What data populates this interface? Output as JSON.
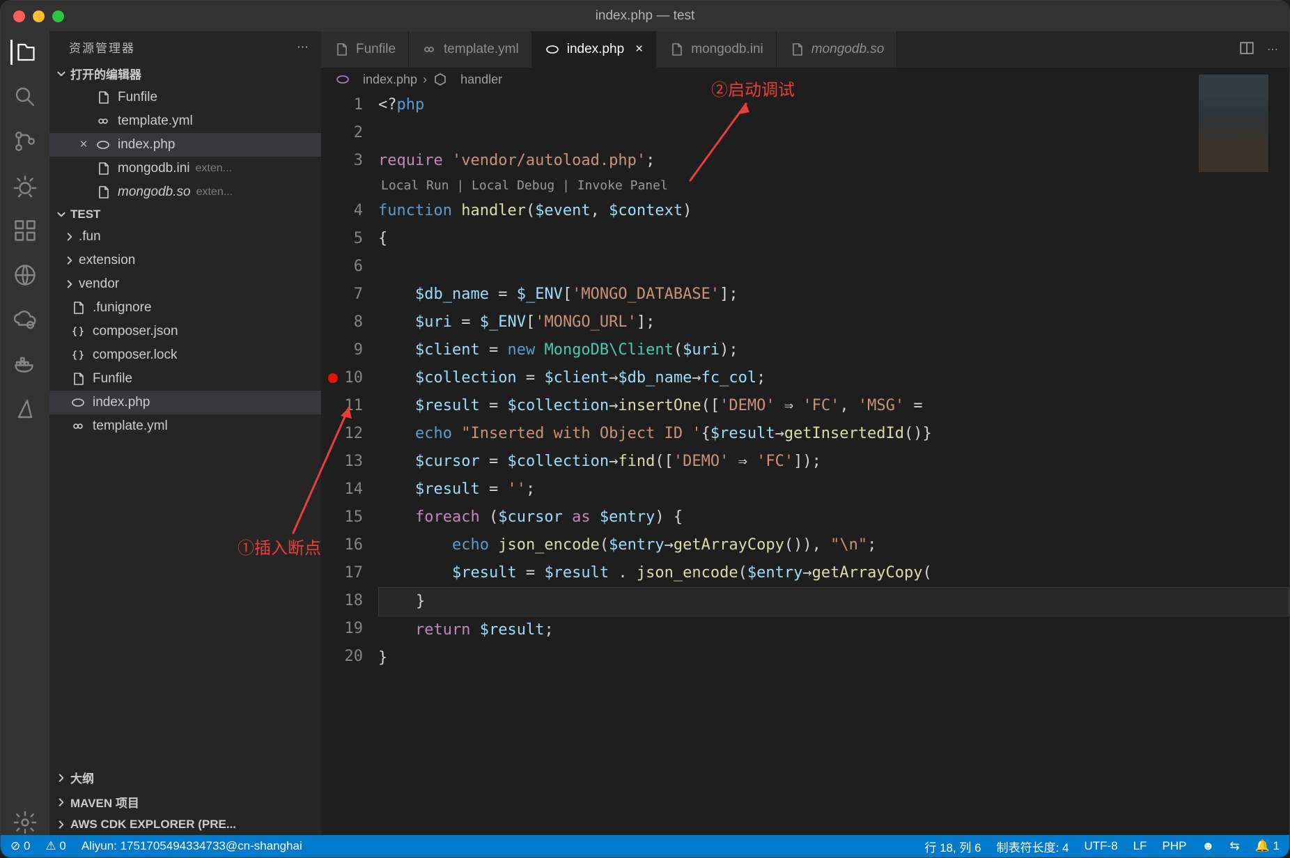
{
  "window_title": "index.php — test",
  "sidebar": {
    "explorer_label": "资源管理器",
    "open_editors_label": "打开的编辑器",
    "open_editors": [
      {
        "icon": "file",
        "name": "Funfile"
      },
      {
        "icon": "yml",
        "name": "template.yml"
      },
      {
        "icon": "php",
        "name": "index.php",
        "close": true,
        "active": true
      },
      {
        "icon": "file",
        "name": "mongodb.ini",
        "meta": "exten..."
      },
      {
        "icon": "file",
        "name": "mongodb.so",
        "meta": "exten...",
        "italic": true
      }
    ],
    "workspace_label": "TEST",
    "tree": [
      {
        "t": "folder",
        "name": ".fun"
      },
      {
        "t": "folder",
        "name": "extension"
      },
      {
        "t": "folder",
        "name": "vendor"
      },
      {
        "t": "file",
        "icon": "file",
        "name": ".funignore"
      },
      {
        "t": "file",
        "icon": "json",
        "name": "composer.json"
      },
      {
        "t": "file",
        "icon": "json",
        "name": "composer.lock"
      },
      {
        "t": "file",
        "icon": "file",
        "name": "Funfile"
      },
      {
        "t": "file",
        "icon": "php",
        "name": "index.php",
        "active": true
      },
      {
        "t": "file",
        "icon": "yml",
        "name": "template.yml"
      }
    ],
    "sections": [
      "大纲",
      "MAVEN 项目",
      "AWS CDK EXPLORER (PRE..."
    ]
  },
  "tabs": [
    {
      "icon": "file",
      "label": "Funfile"
    },
    {
      "icon": "yml",
      "label": "template.yml"
    },
    {
      "icon": "php",
      "label": "index.php",
      "active": true,
      "close": true
    },
    {
      "icon": "file",
      "label": "mongodb.ini"
    },
    {
      "icon": "file",
      "label": "mongodb.so",
      "italic": true
    }
  ],
  "crumbs": [
    "index.php",
    "handler"
  ],
  "codelens": "Local Run | Local Debug | Invoke Panel",
  "annotations": {
    "a1": "①插入断点",
    "a2": "②启动调试"
  },
  "code_lines": [
    {
      "n": 1,
      "html": "<span class='p'>&lt;?</span><span class='kb'>php</span>"
    },
    {
      "n": 2,
      "html": ""
    },
    {
      "n": 3,
      "html": "<span class='k'>require</span><span class='p'>&nbsp;</span><span class='str'>'vendor/autoload.php'</span><span class='p'>;</span>"
    },
    {
      "codelens": true
    },
    {
      "n": 4,
      "html": "<span class='kb'>function</span><span class='p'>&nbsp;</span><span class='fn'>handler</span><span class='p'>(</span><span class='var'>$event</span><span class='p'>,&nbsp;</span><span class='var'>$context</span><span class='p'>)</span>"
    },
    {
      "n": 5,
      "html": "<span class='p'>{</span>"
    },
    {
      "n": 6,
      "html": ""
    },
    {
      "n": 7,
      "html": "<span class='p'>&nbsp;&nbsp;&nbsp;&nbsp;</span><span class='var'>$db_name</span><span class='p'>&nbsp;=&nbsp;</span><span class='var'>$_ENV</span><span class='p'>[</span><span class='str'>'MONGO_DATABASE'</span><span class='p'>];</span>"
    },
    {
      "n": 8,
      "html": "<span class='p'>&nbsp;&nbsp;&nbsp;&nbsp;</span><span class='var'>$uri</span><span class='p'>&nbsp;=&nbsp;</span><span class='var'>$_ENV</span><span class='p'>[</span><span class='str'>'MONGO_URL'</span><span class='p'>];</span>"
    },
    {
      "n": 9,
      "html": "<span class='p'>&nbsp;&nbsp;&nbsp;&nbsp;</span><span class='var'>$client</span><span class='p'>&nbsp;=&nbsp;</span><span class='kb'>new</span><span class='p'>&nbsp;</span><span class='cls'>MongoDB\\Client</span><span class='p'>(</span><span class='var'>$uri</span><span class='p'>);</span>"
    },
    {
      "n": 10,
      "bp": true,
      "html": "<span class='p'>&nbsp;&nbsp;&nbsp;&nbsp;</span><span class='var'>$collection</span><span class='p'>&nbsp;=&nbsp;</span><span class='var'>$client</span><span class='p'>→</span><span class='var'>$db_name</span><span class='p'>→</span><span class='var'>fc_col</span><span class='p'>;</span>"
    },
    {
      "n": 11,
      "html": "<span class='p'>&nbsp;&nbsp;&nbsp;&nbsp;</span><span class='var'>$result</span><span class='p'>&nbsp;=&nbsp;</span><span class='var'>$collection</span><span class='p'>→</span><span class='fn'>insertOne</span><span class='p'>([</span><span class='str'>'DEMO'</span><span class='p'>&nbsp;⇒&nbsp;</span><span class='str'>'FC'</span><span class='p'>,&nbsp;</span><span class='str'>'MSG'</span><span class='p'>&nbsp;=</span>"
    },
    {
      "n": 12,
      "html": "<span class='p'>&nbsp;&nbsp;&nbsp;&nbsp;</span><span class='kb'>echo</span><span class='p'>&nbsp;</span><span class='str'>\"Inserted&nbsp;with&nbsp;Object&nbsp;ID&nbsp;'</span><span class='p'>{</span><span class='var'>$result</span><span class='p'>→</span><span class='fn'>getInsertedId</span><span class='p'>()}</span>"
    },
    {
      "n": 13,
      "html": "<span class='p'>&nbsp;&nbsp;&nbsp;&nbsp;</span><span class='var'>$cursor</span><span class='p'>&nbsp;=&nbsp;</span><span class='var'>$collection</span><span class='p'>→</span><span class='fn'>find</span><span class='p'>([</span><span class='str'>'DEMO'</span><span class='p'>&nbsp;⇒&nbsp;</span><span class='str'>'FC'</span><span class='p'>]);</span>"
    },
    {
      "n": 14,
      "html": "<span class='p'>&nbsp;&nbsp;&nbsp;&nbsp;</span><span class='var'>$result</span><span class='p'>&nbsp;=&nbsp;</span><span class='str'>''</span><span class='p'>;</span>"
    },
    {
      "n": 15,
      "html": "<span class='p'>&nbsp;&nbsp;&nbsp;&nbsp;</span><span class='k'>foreach</span><span class='p'>&nbsp;(</span><span class='var'>$cursor</span><span class='p'>&nbsp;</span><span class='k'>as</span><span class='p'>&nbsp;</span><span class='var'>$entry</span><span class='p'>)&nbsp;{</span>"
    },
    {
      "n": 16,
      "html": "<span class='p'>&nbsp;&nbsp;&nbsp;&nbsp;&nbsp;&nbsp;&nbsp;&nbsp;</span><span class='kb'>echo</span><span class='p'>&nbsp;</span><span class='fn'>json_encode</span><span class='p'>(</span><span class='var'>$entry</span><span class='p'>→</span><span class='fn'>getArrayCopy</span><span class='p'>()),&nbsp;</span><span class='str'>\"\\n\"</span><span class='p'>;</span>"
    },
    {
      "n": 17,
      "html": "<span class='p'>&nbsp;&nbsp;&nbsp;&nbsp;&nbsp;&nbsp;&nbsp;&nbsp;</span><span class='var'>$result</span><span class='p'>&nbsp;=&nbsp;</span><span class='var'>$result</span><span class='p'>&nbsp;.&nbsp;</span><span class='fn'>json_encode</span><span class='p'>(</span><span class='var'>$entry</span><span class='p'>→</span><span class='fn'>getArrayCopy</span><span class='p'>(</span>"
    },
    {
      "n": 18,
      "hl": true,
      "html": "<span class='p'>&nbsp;&nbsp;&nbsp;&nbsp;}</span>"
    },
    {
      "n": 19,
      "html": "<span class='p'>&nbsp;&nbsp;&nbsp;&nbsp;</span><span class='k'>return</span><span class='p'>&nbsp;</span><span class='var'>$result</span><span class='p'>;</span>"
    },
    {
      "n": 20,
      "html": "<span class='p'>}</span>"
    }
  ],
  "status": {
    "errors": "⊘ 0",
    "warnings": "⚠ 0",
    "aliyun": "Aliyun: 1751705494334733@cn-shanghai",
    "ln": "行 18, 列 6",
    "tab": "制表符长度: 4",
    "enc": "UTF-8",
    "eol": "LF",
    "lang": "PHP",
    "bell": "1"
  }
}
